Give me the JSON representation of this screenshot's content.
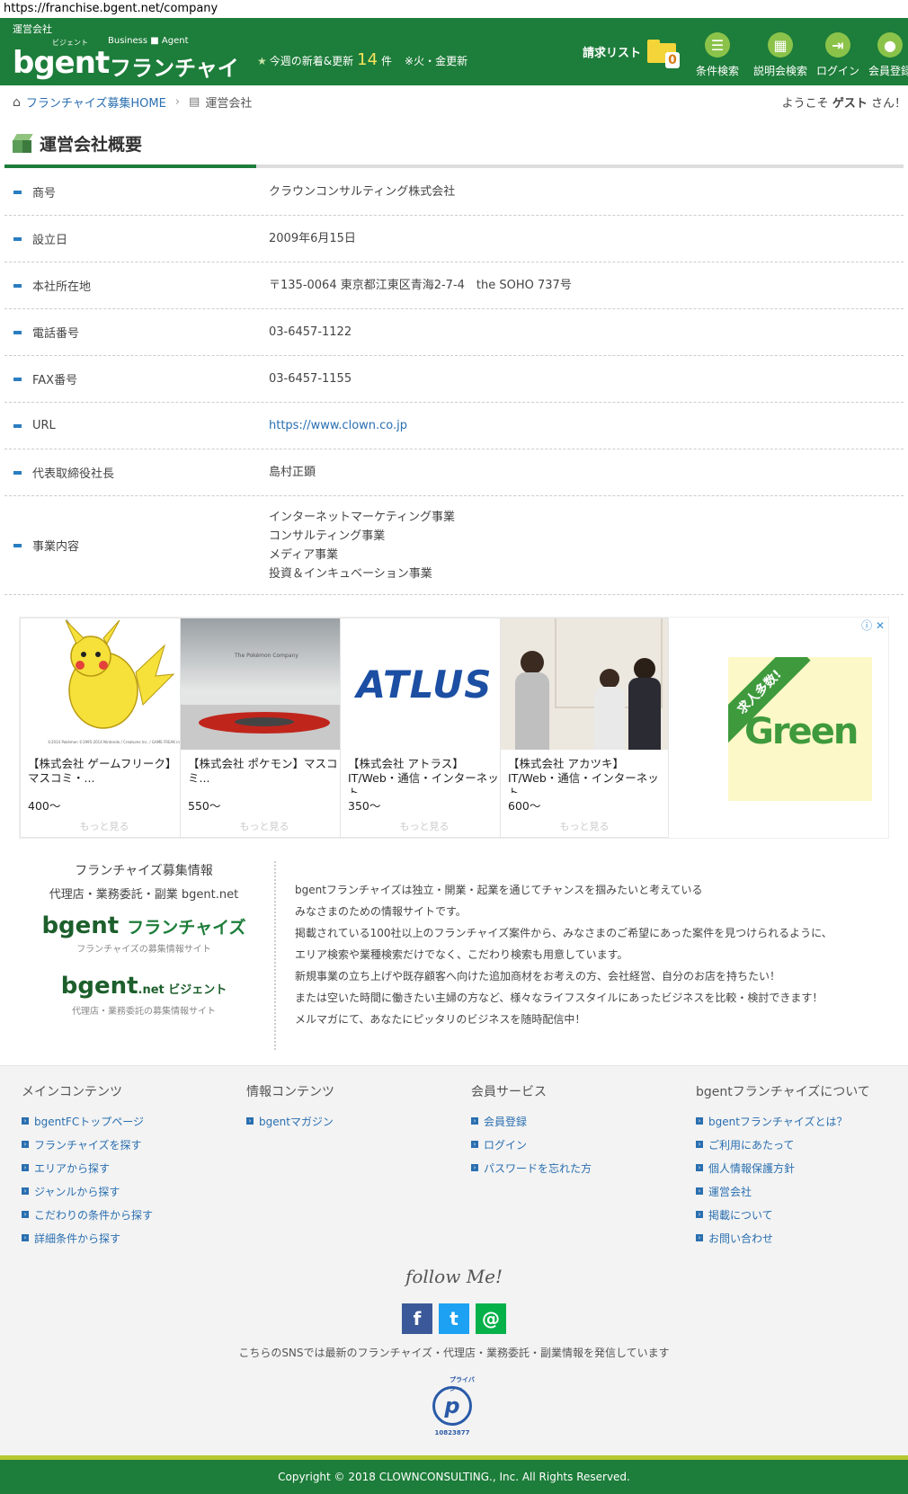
{
  "url": "https://franchise.bgent.net/company",
  "header": {
    "small_label": "運営会社",
    "logo_ruby": "ビジェント",
    "logo_business_agent": "Business ■ Agent",
    "logo_main": "bgent",
    "logo_franchise": "フランチャイズ",
    "news_prefix": "今週の新着&更新",
    "news_count": "14",
    "news_unit": "件",
    "news_note": "※火・金更新",
    "request_list": "請求リスト",
    "request_count": "0",
    "nav": [
      {
        "label": "条件検索",
        "icon": "list-icon"
      },
      {
        "label": "説明会検索",
        "icon": "calendar-icon"
      },
      {
        "label": "ログイン",
        "icon": "login-icon"
      },
      {
        "label": "会員登録",
        "icon": "user-icon"
      }
    ]
  },
  "breadcrumb": {
    "home": "フランチャイズ募集HOME",
    "current": "運営会社"
  },
  "welcome": {
    "prefix": "ようこそ",
    "name": "ゲスト",
    "suffix": "さん！"
  },
  "page_title": "運営会社概要",
  "company": [
    {
      "key": "商号",
      "value": "クラウンコンサルティング株式会社"
    },
    {
      "key": "設立日",
      "value": "2009年6月15日"
    },
    {
      "key": "本社所在地",
      "value": "〒135-0064 東京都江東区青海2-7-4　the SOHO 737号"
    },
    {
      "key": "電話番号",
      "value": "03-6457-1122"
    },
    {
      "key": "FAX番号",
      "value": "03-6457-1155"
    },
    {
      "key": "URL",
      "value": "https://www.clown.co.jp"
    },
    {
      "key": "代表取締役社長",
      "value": "島村正顕"
    }
  ],
  "business": {
    "key": "事業内容",
    "lines": [
      "インターネットマーケティング事業",
      "コンサルティング事業",
      "メディア事業",
      "投資＆インキュベーション事業"
    ]
  },
  "ads": [
    {
      "title": "【株式会社 ゲームフリーク】マスコミ・...",
      "salary": "400〜",
      "more": "もっと見る",
      "image_caption": "©2014 Pokémon ©1995-2014 Nintendo / Creatures Inc. / GAME FREAK inc."
    },
    {
      "title": "【株式会社 ポケモン】マスコミ...",
      "salary": "550〜",
      "more": "もっと見る",
      "image_caption": "The Pokémon Company"
    },
    {
      "title": "【株式会社 アトラス】IT/Web・通信・インターネット...",
      "salary": "350〜",
      "more": "もっと見る",
      "image_caption": "ATLUS"
    },
    {
      "title": "【株式会社 アカツキ】IT/Web・通信・インターネット...",
      "salary": "600〜",
      "more": "もっと見る",
      "image_caption": ""
    }
  ],
  "green_ad": {
    "band": "求人多数!",
    "word": "Green"
  },
  "about": {
    "left_title": "フランチャイズ募集情報",
    "left_sub": "代理店・業務委託・副業 bgent.net",
    "logo1_main": "bgent",
    "logo1_sub": "フランチャイズ",
    "logo1_caption": "フランチャイズの募集情報サイト",
    "logo2_main": "bgent",
    "logo2_sub": ".net ビジェント",
    "logo2_caption": "代理店・業務委託の募集情報サイト",
    "lines": [
      "bgentフランチャイズは独立・開業・起業を通じてチャンスを掴みたいと考えている",
      "みなさまのための情報サイトです。",
      "掲載されている100社以上のフランチャイズ案件から、みなさまのご希望にあった案件を見つけられるように、",
      "エリア検索や業種検索だけでなく、こだわり検索も用意しています。",
      "新規事業の立ち上げや既存顧客へ向けた追加商材をお考えの方、会社経営、自分のお店を持ちたい！",
      "または空いた時間に働きたい主婦の方など、様々なライフスタイルにあったビジネスを比較・検討できます！",
      "メルマガにて、あなたにピッタリのビジネスを随時配信中！"
    ]
  },
  "footer": {
    "columns": [
      {
        "title": "メインコンテンツ",
        "items": [
          "bgentFCトップページ",
          "フランチャイズを探す",
          "エリアから探す",
          "ジャンルから探す",
          "こだわりの条件から探す",
          "詳細条件から探す"
        ]
      },
      {
        "title": "情報コンテンツ",
        "items": [
          "bgentマガジン"
        ]
      },
      {
        "title": "会員サービス",
        "items": [
          "会員登録",
          "ログイン",
          "パスワードを忘れた方"
        ]
      },
      {
        "title": "bgentフランチャイズについて",
        "items": [
          "bgentフランチャイズとは？",
          "ご利用にあたって",
          "個人情報保護方針",
          "運営会社",
          "掲載について",
          "お問い合わせ"
        ]
      }
    ],
    "follow": "follow Me!",
    "sns_note": "こちらのSNSでは最新のフランチャイズ・代理店・業務委託・副業情報を発信しています",
    "privacy_number": "10823877",
    "privacy_mark": "プライバシー",
    "copyright": "Copyright © 2018 CLOWNCONSULTING., Inc. All Rights Reserved."
  }
}
